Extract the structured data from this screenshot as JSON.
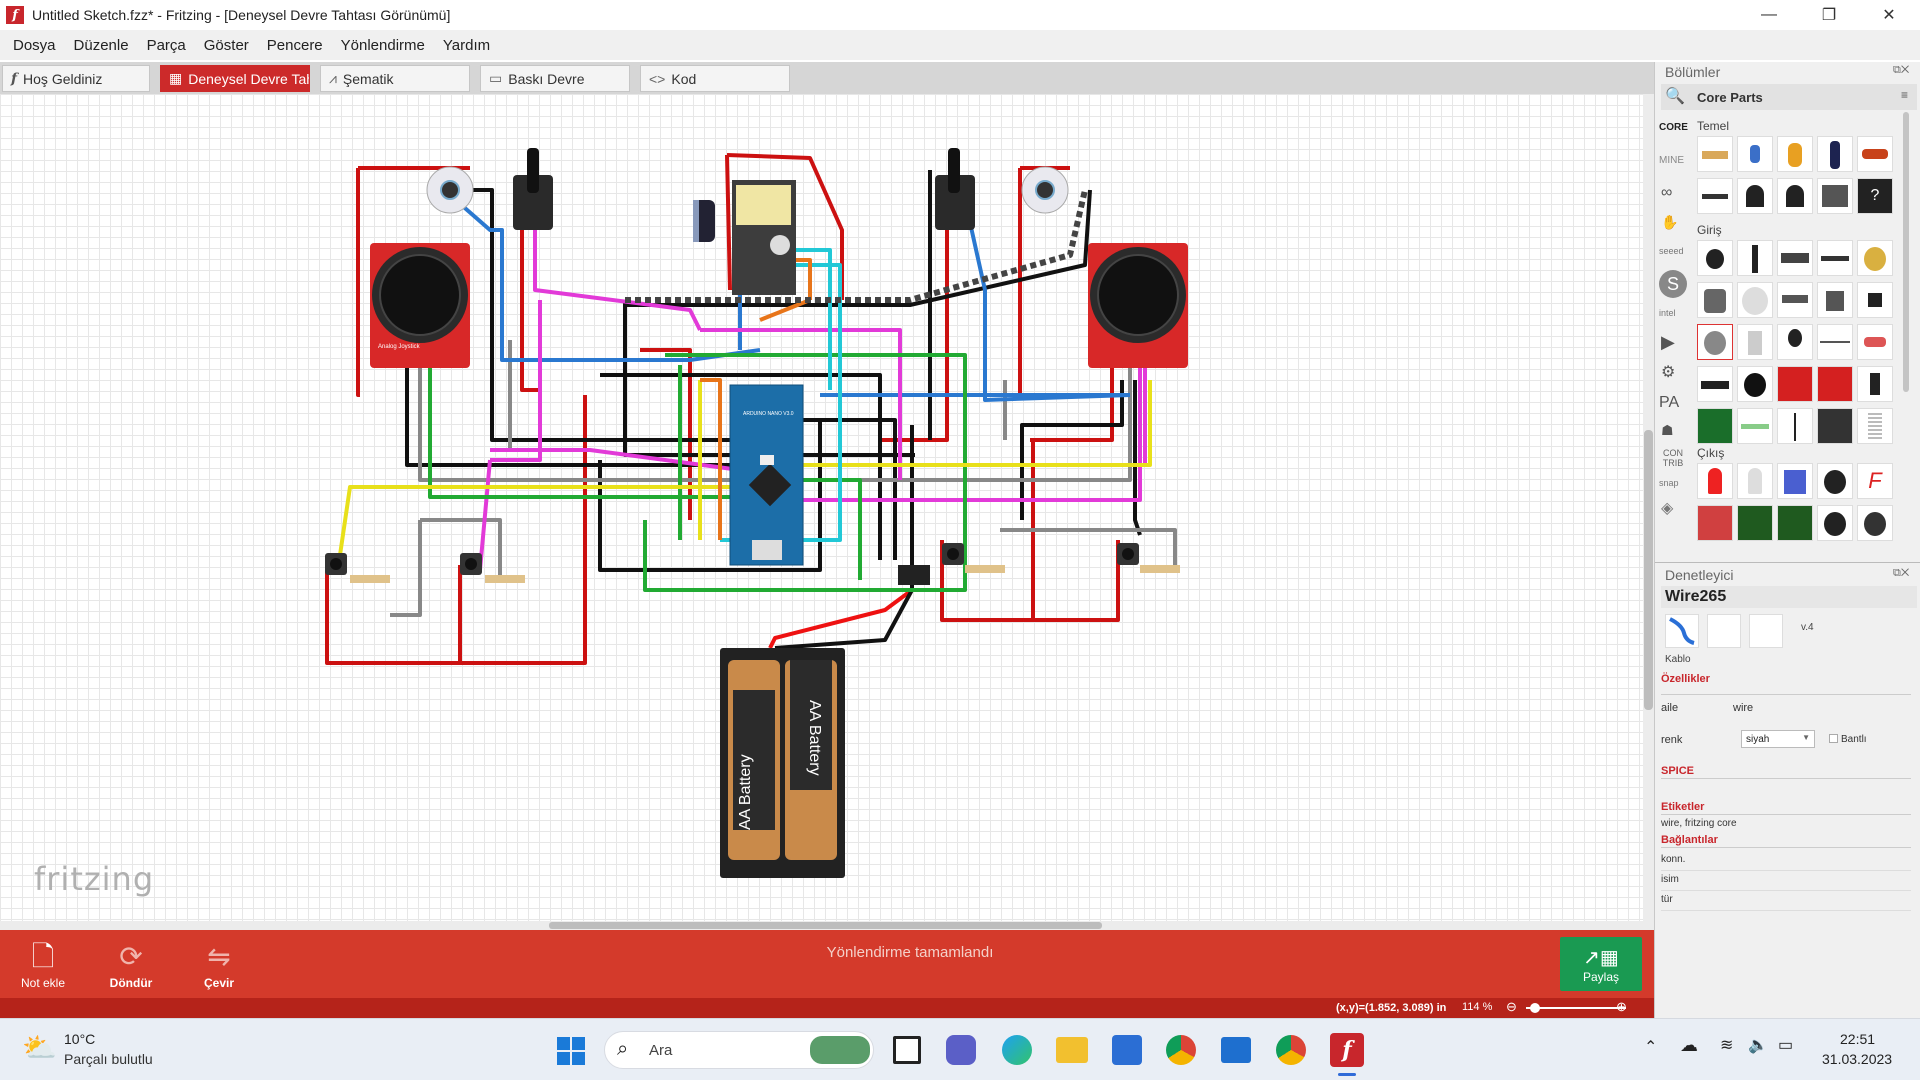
{
  "window": {
    "title": "Untitled Sketch.fzz* - Fritzing - [Deneysel Devre Tahtası Görünümü]",
    "controls": {
      "minimize": "—",
      "restore": "❐",
      "close": "✕"
    }
  },
  "menu": [
    "Dosya",
    "Düzenle",
    "Parça",
    "Göster",
    "Pencere",
    "Yönlendirme",
    "Yardım"
  ],
  "tabs": [
    {
      "label": "Hoş Geldiniz",
      "icon": "fritzing-f-icon"
    },
    {
      "label": "Deneysel Devre Tahtası",
      "icon": "breadboard-icon",
      "active": true
    },
    {
      "label": "Şematik",
      "icon": "schematic-icon"
    },
    {
      "label": "Baskı Devre",
      "icon": "pcb-icon"
    },
    {
      "label": "Kod",
      "icon": "code-icon"
    }
  ],
  "canvas": {
    "watermark": "fritzing",
    "battery_labels": [
      "AA Battery",
      "AA Battery"
    ],
    "arduino_label": "ARDUINO NANO V3.0",
    "joystick_label": "Analog Joystick"
  },
  "toolbar": {
    "add_note": "Not ekle",
    "rotate": "Döndür",
    "flip": "Çevir",
    "routing_status": "Yönlendirme tamamlandı",
    "share": "Paylaş"
  },
  "statusbar": {
    "coords": "(x,y)=(1.852, 3.089) in",
    "zoom": "114 %"
  },
  "parts_panel": {
    "title": "Bölümler",
    "search_title": "Core Parts",
    "bins": [
      "CORE",
      "MINE",
      "∞",
      "✋",
      "seeed",
      "S",
      "intel",
      "▶",
      "⚙",
      "PA",
      "☗",
      "CON TRIB",
      "snap",
      "◈"
    ],
    "sections": [
      "Temel",
      "Giriş",
      "Çıkış"
    ]
  },
  "inspector": {
    "title": "Denetleyici",
    "part_name": "Wire265",
    "part_type": "Kablo",
    "version": "v.4",
    "properties_label": "Özellikler",
    "family_label": "aile",
    "family_value": "wire",
    "color_label": "renk",
    "color_value": "siyah",
    "banded_label": "Bantlı",
    "spice_label": "SPICE",
    "tags_label": "Etiketler",
    "tags_value": "wire, fritzing core",
    "connections_label": "Bağlantılar",
    "conn_rows": [
      "konn.",
      "isim",
      "tür"
    ]
  },
  "taskbar": {
    "weather_temp": "10°C",
    "weather_desc": "Parçalı bulutlu",
    "search_placeholder": "Ara",
    "time": "22:51",
    "date": "31.03.2023"
  },
  "colors": {
    "accent": "#d43a2b",
    "share": "#1a9a52",
    "active_tab": "#cc2a2a"
  }
}
